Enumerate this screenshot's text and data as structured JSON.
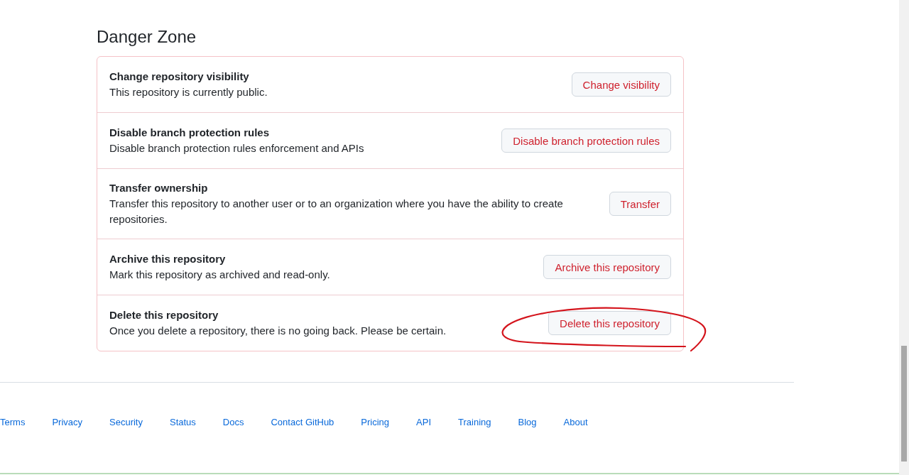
{
  "section_title": "Danger Zone",
  "rows": [
    {
      "title": "Change repository visibility",
      "description": "This repository is currently public.",
      "button": "Change visibility"
    },
    {
      "title": "Disable branch protection rules",
      "description": "Disable branch protection rules enforcement and APIs",
      "button": "Disable branch protection rules"
    },
    {
      "title": "Transfer ownership",
      "description": "Transfer this repository to another user or to an organization where you have the ability to create repositories.",
      "button": "Transfer"
    },
    {
      "title": "Archive this repository",
      "description": "Mark this repository as archived and read-only.",
      "button": "Archive this repository"
    },
    {
      "title": "Delete this repository",
      "description": "Once you delete a repository, there is no going back. Please be certain.",
      "button": "Delete this repository"
    }
  ],
  "footer_links": [
    "Terms",
    "Privacy",
    "Security",
    "Status",
    "Docs",
    "Contact GitHub",
    "Pricing",
    "API",
    "Training",
    "Blog",
    "About"
  ]
}
